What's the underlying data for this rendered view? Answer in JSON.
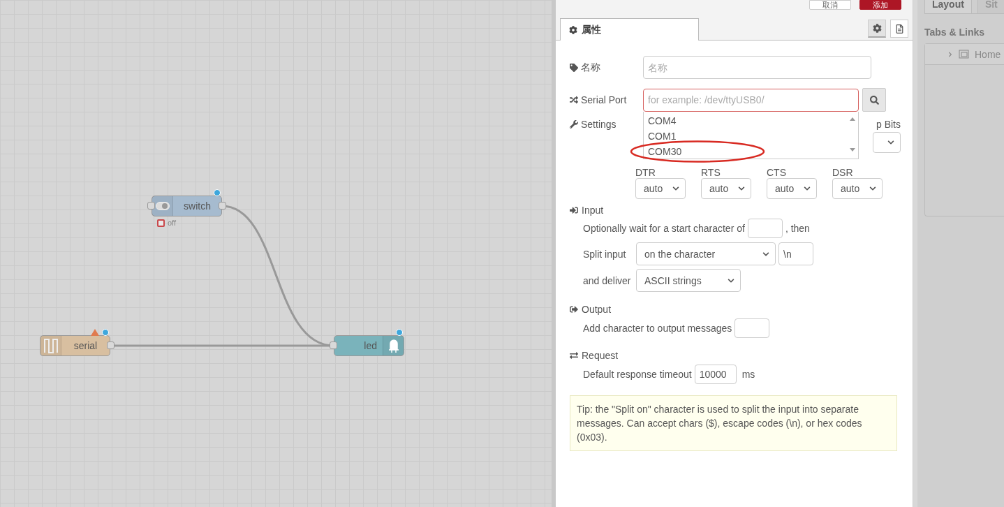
{
  "canvas": {
    "nodes": [
      {
        "kind": "switch",
        "label": "switch",
        "color": "#a6bbcf",
        "changed": true,
        "warning": false,
        "status": "off"
      },
      {
        "kind": "serial",
        "label": "serial",
        "color": "#d8bfa0",
        "changed": true,
        "warning": true
      },
      {
        "kind": "led",
        "label": "led",
        "color": "#7ab3bb",
        "changed": true,
        "warning": false
      }
    ]
  },
  "editor": {
    "actions": [
      {
        "label": "取消",
        "kind": "secondary"
      },
      {
        "label": "添加",
        "kind": "primary"
      }
    ],
    "tabs": [
      {
        "label": "属性",
        "selected": true
      }
    ],
    "tab_tools": [
      {
        "kind": "settings",
        "selected": true
      },
      {
        "kind": "description",
        "selected": false
      }
    ],
    "name": {
      "label": "名称",
      "placeholder": "名称"
    },
    "serial_port": {
      "label": "Serial Port",
      "placeholder": "for example: /dev/ttyUSB0/",
      "error": true,
      "options": [
        "COM4",
        "COM1",
        "COM30"
      ]
    },
    "settings": {
      "label": "Settings",
      "column_4": "p Bits"
    },
    "flow_controls": [
      {
        "label": "DTR",
        "value": "auto"
      },
      {
        "label": "RTS",
        "value": "auto"
      },
      {
        "label": "CTS",
        "value": "auto"
      },
      {
        "label": "DSR",
        "value": "auto"
      }
    ],
    "input": {
      "title": "Input",
      "wait_label": "Optionally wait for a start character of",
      "wait_suffix": ", then",
      "split_label": "Split input",
      "split_value": "on the character",
      "split_char": "\\n",
      "deliver_label": "and deliver",
      "deliver_value": "ASCII strings"
    },
    "output": {
      "title": "Output",
      "add_label": "Add character to output messages"
    },
    "request": {
      "title": "Request",
      "timeout_label": "Default response timeout",
      "timeout_value": "10000",
      "unit": "ms"
    },
    "tip": "Tip: the \"Split on\" character is used to split the input into separate messages. Can accept chars ($), escape codes (\\n), or hex codes (0x03)."
  },
  "sidebar": {
    "tabs": [
      {
        "label": "Layout",
        "selected": true
      },
      {
        "label": "Sit",
        "selected": false
      }
    ],
    "section": "Tabs & Links",
    "tree": [
      {
        "label": "Home",
        "expanded": false
      }
    ]
  }
}
